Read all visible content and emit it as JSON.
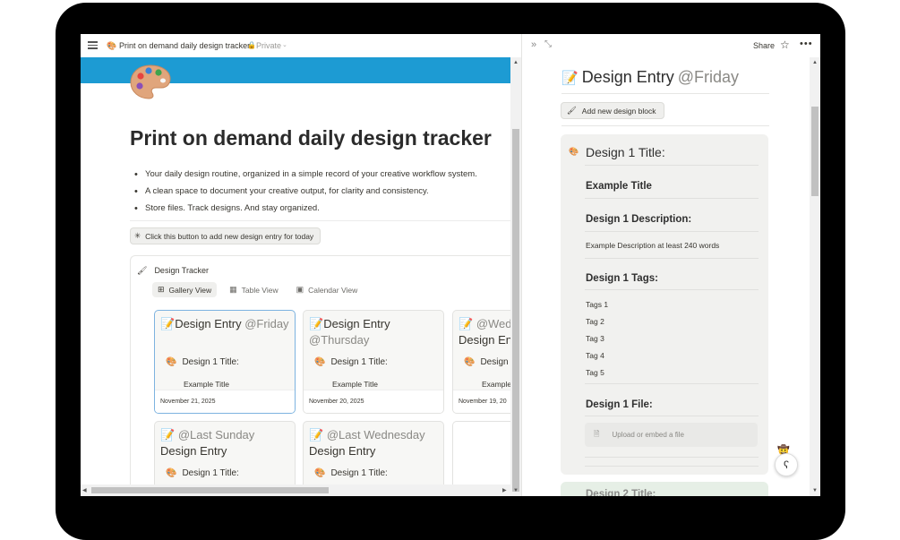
{
  "left": {
    "breadcrumb": {
      "icon": "palette-icon",
      "title": "Print on demand daily design tracker",
      "privacy": "Private"
    },
    "page": {
      "title": "Print on demand daily design tracker",
      "bullets": [
        "Your daily design routine, organized in a simple record of your creative workflow system.",
        "A clean space to document your creative output, for clarity and consistency.",
        "Store files. Track designs. And stay organized."
      ],
      "add_button": "Click this button to add new design entry for today"
    },
    "database": {
      "title": "Design Tracker",
      "views": [
        {
          "label": "Gallery View",
          "icon": "grid-icon",
          "active": true
        },
        {
          "label": "Table View",
          "icon": "table-icon",
          "active": false
        },
        {
          "label": "Calendar View",
          "icon": "calendar-icon",
          "active": false
        }
      ],
      "cards": [
        {
          "name": "Design Entry",
          "mention": "@Friday",
          "prop": "Design 1 Title:",
          "value": "Example Title",
          "date": "November 21, 2025"
        },
        {
          "name": "Design Entry",
          "mention": "@Thursday",
          "prop": "Design 1 Title:",
          "value": "Example Title",
          "date": "November 20, 2025"
        },
        {
          "name": "Design En",
          "mention": "@Wed",
          "prop": "Design",
          "value": "Example",
          "date": "November 19, 20"
        },
        {
          "name": "Design Entry",
          "mention": "@Last Sunday",
          "prop": "Design 1 Title:"
        },
        {
          "name": "Design Entry",
          "mention": "@Last Wednesday",
          "prop": "Design 1 Title:"
        }
      ]
    }
  },
  "right": {
    "toolbar": {
      "share": "Share"
    },
    "title": {
      "name": "Design Entry",
      "mention": "@Friday"
    },
    "add_block_button": "Add new design block",
    "block": {
      "title_label": "Design 1 Title:",
      "title_value": "Example Title",
      "desc_label": "Design 1 Description:",
      "desc_value": "Example Description at least 240 words",
      "tags_label": "Design 1 Tags:",
      "tags": [
        "Tags 1",
        "Tag 2",
        "Tag 3",
        "Tag 4",
        "Tag 5"
      ],
      "file_label": "Design 1 File:",
      "upload_text": "Upload or embed a file"
    },
    "next_block_label": "Design 2 Title:"
  }
}
